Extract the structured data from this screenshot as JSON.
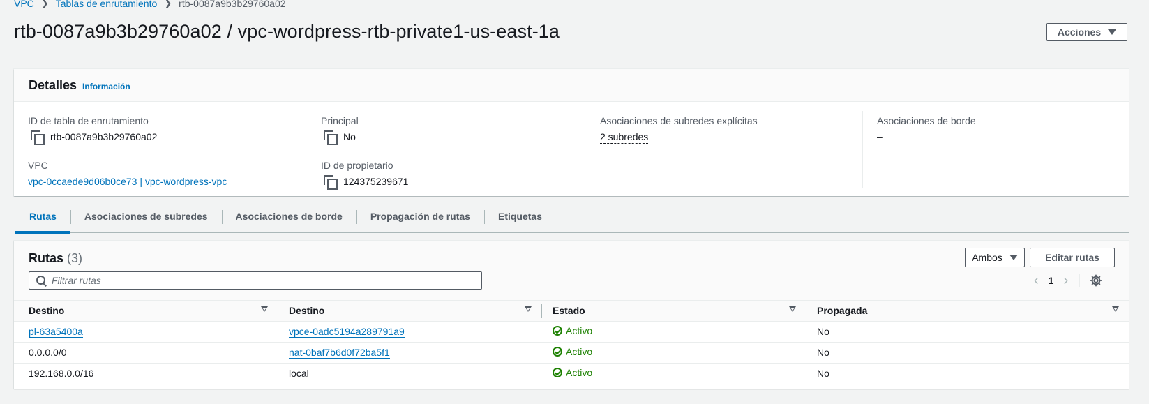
{
  "breadcrumb": {
    "items": [
      "VPC",
      "Tablas de enrutamiento",
      "rtb-0087a9b3b29760a02"
    ]
  },
  "header": {
    "title": "rtb-0087a9b3b29760a02 / vpc-wordpress-rtb-private1-us-east-1a",
    "actions_label": "Acciones"
  },
  "details": {
    "title": "Detalles",
    "info_label": "Información",
    "route_table_id_label": "ID de tabla de enrutamiento",
    "route_table_id": "rtb-0087a9b3b29760a02",
    "vpc_label": "VPC",
    "vpc_value": "vpc-0ccaede9d06b0ce73 | vpc-wordpress-vpc",
    "main_label": "Principal",
    "main_value": "No",
    "owner_label": "ID de propietario",
    "owner_value": "124375239671",
    "subnet_assoc_label": "Asociaciones de subredes explícitas",
    "subnet_assoc_value": "2 subredes",
    "edge_assoc_label": "Asociaciones de borde",
    "edge_assoc_value": "–"
  },
  "tabs": [
    {
      "label": "Rutas",
      "active": true
    },
    {
      "label": "Asociaciones de subredes",
      "active": false
    },
    {
      "label": "Asociaciones de borde",
      "active": false
    },
    {
      "label": "Propagación de rutas",
      "active": false
    },
    {
      "label": "Etiquetas",
      "active": false
    }
  ],
  "routes": {
    "title": "Rutas",
    "count": "(3)",
    "filter_button_label": "Ambos",
    "edit_button_label": "Editar rutas",
    "search_placeholder": "Filtrar rutas",
    "page_number": "1",
    "columns": [
      "Destino",
      "Destino",
      "Estado",
      "Propagada"
    ],
    "rows": [
      {
        "destination": "pl-63a5400a",
        "target": "vpce-0adc5194a289791a9",
        "status": "Activo",
        "propagated": "No"
      },
      {
        "destination": "0.0.0.0/0",
        "target": "nat-0baf7b6d0f72ba5f1",
        "status": "Activo",
        "propagated": "No"
      },
      {
        "destination": "192.168.0.0/16",
        "target": "local",
        "status": "Activo",
        "propagated": "No"
      }
    ]
  },
  "colors": {
    "link": "#0073bb",
    "success": "#1d8102",
    "background": "#f2f3f3"
  }
}
